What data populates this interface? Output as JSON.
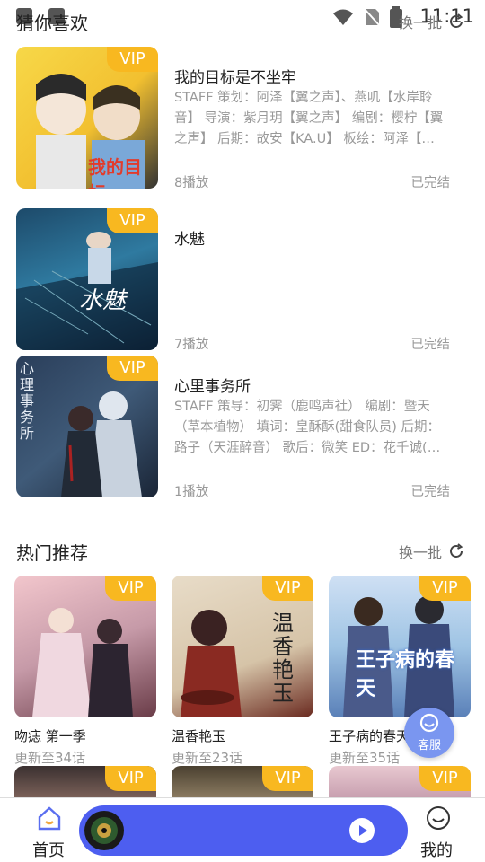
{
  "status_bar": {
    "time": "11:11"
  },
  "guess_section": {
    "title": "猜你喜欢",
    "action_label": "换一批",
    "items": [
      {
        "title": "我的目标是不坐牢",
        "description": "STAFF 策划：阿泽【翼之声】、燕叽【水岸聆音】 导演：紫月玥【翼之声】 编剧：樱柠【翼之声】 后期：故安【KA.U】 板绘：阿泽【…",
        "plays": "8播放",
        "status": "已完结",
        "vip": "VIP",
        "cover_text": "我的目标"
      },
      {
        "title": "水魅",
        "description": "",
        "plays": "7播放",
        "status": "已完结",
        "vip": "VIP",
        "cover_text": "水魅"
      },
      {
        "title": "心里事务所",
        "description": "STAFF 策导：初霁（鹿鸣声社） 编剧：暨天（草本植物） 填词：皇酥酥(甜食队员) 后期：路子（天涯醉音） 歌后：微笑 ED：花千诚(…",
        "plays": "1播放",
        "status": "已完结",
        "vip": "VIP",
        "cover_text": "心理事务所"
      }
    ]
  },
  "hot_section": {
    "title": "热门推荐",
    "action_label": "换一批",
    "cards": [
      {
        "title": "吻痣 第一季",
        "subtitle": "更新至34话",
        "vip": "VIP",
        "cover_text": ""
      },
      {
        "title": "温香艳玉",
        "subtitle": "更新至23话",
        "vip": "VIP",
        "cover_text": "温香艳玉"
      },
      {
        "title": "王子病的春天 第…",
        "subtitle": "更新至35话",
        "vip": "VIP",
        "cover_text": "王子病的春天"
      }
    ],
    "row2_vip": [
      "VIP",
      "VIP",
      "VIP"
    ]
  },
  "service_button": {
    "label": "客服"
  },
  "bottom_nav": {
    "home_label": "首页",
    "mine_label": "我的"
  },
  "colors": {
    "vip": "#f8b820",
    "player": "#4d5ef0",
    "service": "#7a96f0"
  }
}
